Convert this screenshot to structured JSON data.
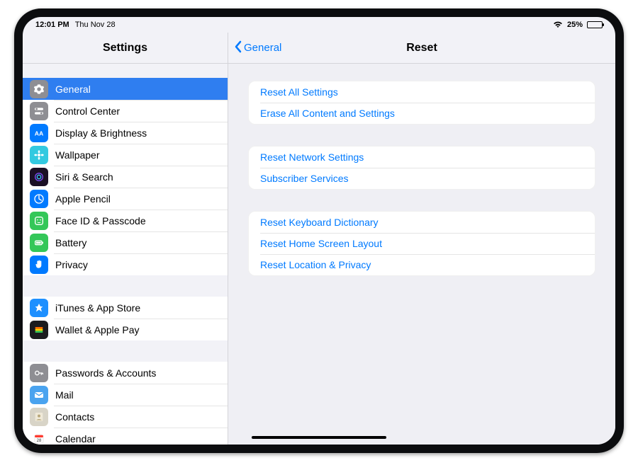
{
  "status": {
    "time": "12:01 PM",
    "date": "Thu Nov 28",
    "battery_pct": "25%"
  },
  "sidebar": {
    "title": "Settings",
    "groups": [
      [
        {
          "icon": "gear",
          "bg": "#8e8e93",
          "label": "General",
          "selected": true
        },
        {
          "icon": "switches",
          "bg": "#8e8e93",
          "label": "Control Center"
        },
        {
          "icon": "aa",
          "bg": "#007aff",
          "label": "Display & Brightness"
        },
        {
          "icon": "flower",
          "bg": "#33c9e0",
          "label": "Wallpaper"
        },
        {
          "icon": "siri",
          "bg": "#1b1025",
          "label": "Siri & Search"
        },
        {
          "icon": "pencil",
          "bg": "#007aff",
          "label": "Apple Pencil"
        },
        {
          "icon": "face",
          "bg": "#34c759",
          "label": "Face ID & Passcode"
        },
        {
          "icon": "battery",
          "bg": "#34c759",
          "label": "Battery"
        },
        {
          "icon": "hand",
          "bg": "#007aff",
          "label": "Privacy"
        }
      ],
      [
        {
          "icon": "appstore",
          "bg": "#1e90ff",
          "label": "iTunes & App Store"
        },
        {
          "icon": "wallet",
          "bg": "#1c1c1e",
          "label": "Wallet & Apple Pay"
        }
      ],
      [
        {
          "icon": "key",
          "bg": "#8e8e93",
          "label": "Passwords & Accounts"
        },
        {
          "icon": "mail",
          "bg": "#4aa3ef",
          "label": "Mail"
        },
        {
          "icon": "contacts",
          "bg": "#d8d4c7",
          "label": "Contacts"
        },
        {
          "icon": "calendar",
          "bg": "#ffffff",
          "label": "Calendar"
        }
      ]
    ]
  },
  "detail": {
    "back_label": "General",
    "title": "Reset",
    "groups": [
      [
        "Reset All Settings",
        "Erase All Content and Settings"
      ],
      [
        "Reset Network Settings",
        "Subscriber Services"
      ],
      [
        "Reset Keyboard Dictionary",
        "Reset Home Screen Layout",
        "Reset Location & Privacy"
      ]
    ]
  }
}
